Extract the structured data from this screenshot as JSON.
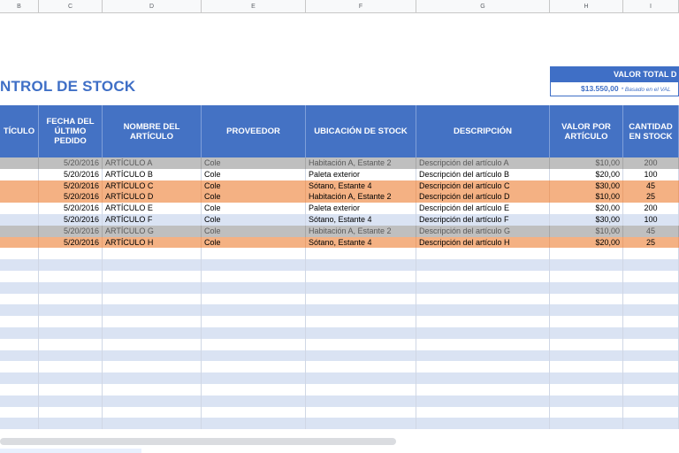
{
  "column_letters": [
    "B",
    "C",
    "D",
    "E",
    "F",
    "G",
    "H",
    "I"
  ],
  "title": "NTROL DE STOCK",
  "valor_total": {
    "label": "VALOR TOTAL D",
    "amount": "$13.550,00",
    "note": "* Basado en el VAL"
  },
  "headers": [
    "TÍCULO",
    "FECHA DEL ÚLTIMO PEDIDO",
    "NOMBRE DEL ARTÍCULO",
    "PROVEEDOR",
    "UBICACIÓN DE STOCK",
    "DESCRIPCIÓN",
    "VALOR POR ARTÍCULO",
    "CANTIDAD EN STOCK"
  ],
  "rows": [
    {
      "style": "gray",
      "cells": [
        "",
        "5/20/2016",
        "ARTÍCULO A",
        "Cole",
        "Habitación A, Estante 2",
        "Descripción del artículo A",
        "$10,00",
        "200"
      ]
    },
    {
      "style": "white",
      "cells": [
        "",
        "5/20/2016",
        "ARTÍCULO B",
        "Cole",
        "Paleta exterior",
        "Descripción del artículo B",
        "$20,00",
        "100"
      ]
    },
    {
      "style": "orange",
      "cells": [
        "",
        "5/20/2016",
        "ARTÍCULO C",
        "Cole",
        "Sótano, Estante 4",
        "Descripción del artículo C",
        "$30,00",
        "45"
      ]
    },
    {
      "style": "orange",
      "cells": [
        "",
        "5/20/2016",
        "ARTÍCULO D",
        "Cole",
        "Habitación A, Estante 2",
        "Descripción del artículo D",
        "$10,00",
        "25"
      ]
    },
    {
      "style": "white",
      "cells": [
        "",
        "5/20/2016",
        "ARTÍCULO E",
        "Cole",
        "Paleta exterior",
        "Descripción del artículo E",
        "$20,00",
        "200"
      ]
    },
    {
      "style": "blue",
      "cells": [
        "",
        "5/20/2016",
        "ARTÍCULO F",
        "Cole",
        "Sótano, Estante 4",
        "Descripción del artículo F",
        "$30,00",
        "100"
      ]
    },
    {
      "style": "gray",
      "cells": [
        "",
        "5/20/2016",
        "ARTÍCULO G",
        "Cole",
        "Habitación A, Estante 2",
        "Descripción del artículo G",
        "$10,00",
        "45"
      ]
    },
    {
      "style": "orange",
      "cells": [
        "",
        "5/20/2016",
        "ARTÍCULO H",
        "Cole",
        "Sótano, Estante 4",
        "Descripción del artículo H",
        "$20,00",
        "25"
      ]
    }
  ],
  "colors": {
    "header_blue": "#4472c4",
    "title_blue": "#3f6fc6",
    "row_gray": "#bfbfbf",
    "row_orange": "#f4b183",
    "row_blue": "#dae3f3"
  }
}
